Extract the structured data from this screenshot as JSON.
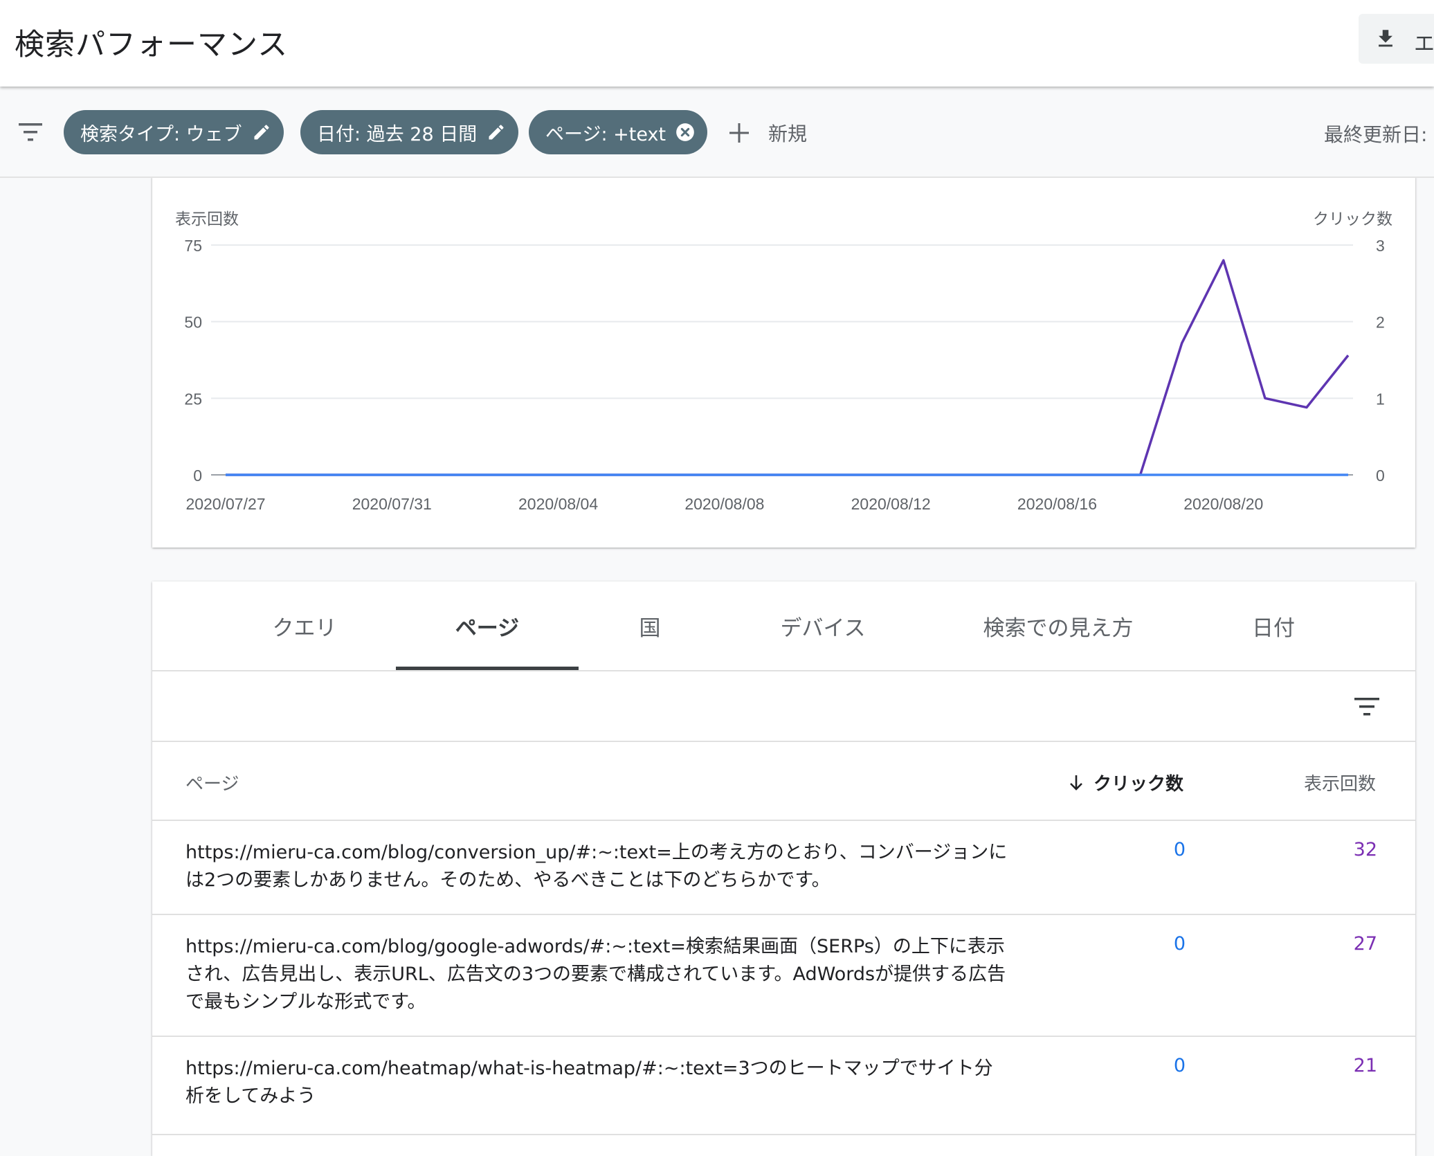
{
  "header": {
    "title": "検索パフォーマンス",
    "export_label": "エ"
  },
  "filters": {
    "chips": [
      {
        "label": "検索タイプ: ウェブ",
        "icon": "pencil-icon"
      },
      {
        "label": "日付: 過去 28 日間",
        "icon": "pencil-icon"
      },
      {
        "label": "ページ: +text",
        "icon": "close-circle-icon"
      }
    ],
    "new_label": "新規",
    "last_updated_label": "最終更新日:"
  },
  "chart_data": {
    "type": "line",
    "title": "",
    "y_left_label": "表示回数",
    "y_right_label": "クリック数",
    "y_left_ticks": [
      "75",
      "50",
      "25",
      "0"
    ],
    "y_right_ticks": [
      "3",
      "2",
      "1",
      "0"
    ],
    "ylim_left": [
      0,
      75
    ],
    "ylim_right": [
      0,
      3
    ],
    "x_tick_labels": [
      "2020/07/27",
      "2020/07/31",
      "2020/08/04",
      "2020/08/08",
      "2020/08/12",
      "2020/08/16",
      "2020/08/20"
    ],
    "x": [
      "2020/07/27",
      "2020/07/28",
      "2020/07/29",
      "2020/07/30",
      "2020/07/31",
      "2020/08/01",
      "2020/08/02",
      "2020/08/03",
      "2020/08/04",
      "2020/08/05",
      "2020/08/06",
      "2020/08/07",
      "2020/08/08",
      "2020/08/09",
      "2020/08/10",
      "2020/08/11",
      "2020/08/12",
      "2020/08/13",
      "2020/08/14",
      "2020/08/15",
      "2020/08/16",
      "2020/08/17",
      "2020/08/18",
      "2020/08/19",
      "2020/08/20",
      "2020/08/21",
      "2020/08/22",
      "2020/08/23"
    ],
    "series": [
      {
        "name": "表示回数",
        "axis": "left",
        "color": "#5e35b1",
        "values": [
          0,
          0,
          0,
          0,
          0,
          0,
          0,
          0,
          0,
          0,
          0,
          0,
          0,
          0,
          0,
          0,
          0,
          0,
          0,
          0,
          0,
          0,
          0,
          43,
          70,
          25,
          22,
          39
        ]
      },
      {
        "name": "クリック数",
        "axis": "right",
        "color": "#4285f4",
        "values": [
          0,
          0,
          0,
          0,
          0,
          0,
          0,
          0,
          0,
          0,
          0,
          0,
          0,
          0,
          0,
          0,
          0,
          0,
          0,
          0,
          0,
          0,
          0,
          0,
          0,
          0,
          0,
          0
        ]
      }
    ],
    "grid": true
  },
  "tabs": [
    {
      "label": "クエリ",
      "active": false
    },
    {
      "label": "ページ",
      "active": true
    },
    {
      "label": "国",
      "active": false
    },
    {
      "label": "デバイス",
      "active": false
    },
    {
      "label": "検索での見え方",
      "active": false
    },
    {
      "label": "日付",
      "active": false
    }
  ],
  "table": {
    "columns": {
      "page": "ページ",
      "clicks": "クリック数",
      "impressions": "表示回数"
    },
    "rows": [
      {
        "page": "https://mieru-ca.com/blog/conversion_up/#:~:text=上の考え方のとおり、コンバージョンには2つの要素しかありません。そのため、やるべきことは下のどちらかです。",
        "clicks": "0",
        "impressions": "32"
      },
      {
        "page": "https://mieru-ca.com/blog/google-adwords/#:~:text=検索結果画面（SERPs）の上下に表示され、広告見出し、表示URL、広告文の3つの要素で構成されています。AdWordsが提供する広告で最もシンプルな形式です。",
        "clicks": "0",
        "impressions": "27"
      },
      {
        "page": "https://mieru-ca.com/heatmap/what-is-heatmap/#:~:text=3つのヒートマップでサイト分析をしてみよう",
        "clicks": "0",
        "impressions": "21"
      }
    ]
  }
}
